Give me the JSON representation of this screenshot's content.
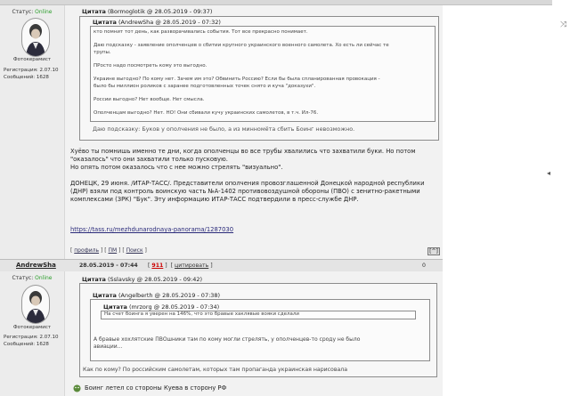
{
  "post1": {
    "status_label": "Статус:",
    "status_value": "Online",
    "rank": "Фотокерамист",
    "reg": "Регистрация: 2.07.10",
    "msgs": "Сообщений: 1628",
    "quote_header_label": "Цитата",
    "quote_header_meta": "(Bormoglotik @ 28.05.2019 - 09:37)",
    "inner_header_label": "Цитата",
    "inner_header_meta": "(AndrewSha @ 28.05.2019 - 07:32)",
    "inner_lines": [
      "кто помнит тот день, как разворачивались события. Тот все прекрасно понимает.",
      "",
      "Даю подсказку - заявление ополченцев о сбитии крупного украинского военного самолета. Хо есть ли сейчас те",
      "трупы.",
      "",
      "ПРосто надо посмотреть кому это выгодно.",
      "",
      "Украине выгодно? По кому нет. Зачем им это? Обвинить Россию? Если бы была спланированная провокация -",
      "было бы миллион роликов с заранее подготовленных точек снято и куча \"доказухи\".",
      "",
      "России выгодно? Нет вообще. Нет смысла.",
      "",
      "Ополченцам выгодно? Нет. НО! Они сбивали кучу украинских самолетов, в т.ч. Ил-76."
    ],
    "outer_reply": "Даю подсказку: Буков у ополчения не было, а из минномёта сбить Боинг невозможно.",
    "body_lines": [
      "Хуёво ты помнишь именно те дни, когда ополченцы во все трубы хвалились что захватили буки. Но потом",
      "\"оказалось\" что они захватили только пусковую.",
      "Но опять потом оказалось что с нее можно стрелять \"визуально\".",
      "",
      "ДОНЕЦК, 29 июня. /ИТАР-ТАСС/. Представители ополчения провозглашенной Донецкой народной республики",
      "(ДНР) взяли под контроль воинскую часть №А-1402 противовоздушной обороны (ПВО) с зенитно-ракетными",
      "комплексами (ЗРК) \"Бук\". Эту информацию ИТАР-ТАСС подтвердили в пресс-службе ДНР."
    ],
    "link": "https://tass.ru/mezhdunarodnaya-panorama/1287030",
    "actions": [
      "профиль",
      "ПМ",
      "Поиск"
    ],
    "scroll_label": "[^]"
  },
  "post2": {
    "author": "AndrewSha",
    "date": "28.05.2019 - 07:44",
    "num": "911",
    "cite": "цитировать",
    "score": "0",
    "status_label": "Статус:",
    "status_value": "Online",
    "rank": "Фотокерамист",
    "reg": "Регистрация: 2.07.10",
    "msgs": "Сообщений: 1628",
    "q1_label": "Цитата",
    "q1_meta": "(Sslavsky @ 28.05.2019 - 09:42)",
    "q2_label": "Цитата",
    "q2_meta": "(Angelberth @ 28.05.2019 - 07:38)",
    "q3_label": "Цитата",
    "q3_meta": "(mrzorg @ 28.05.2019 - 07:34)",
    "q3_text": "На счет боинга я уверен на 146%, что это бравые хаклявые вояки сделали",
    "q2_reply_1": "А бравые хохлятские ПВОшники там по кому могли стрелять, у ополченцев-то сроду не было",
    "q2_reply_2": "авиации...",
    "q1_reply": "Как по кому? По российским самолетам, которых там пропаганда украинская нарисовала",
    "body": "Боинг летел со стороны Куева в сторону РФ"
  }
}
